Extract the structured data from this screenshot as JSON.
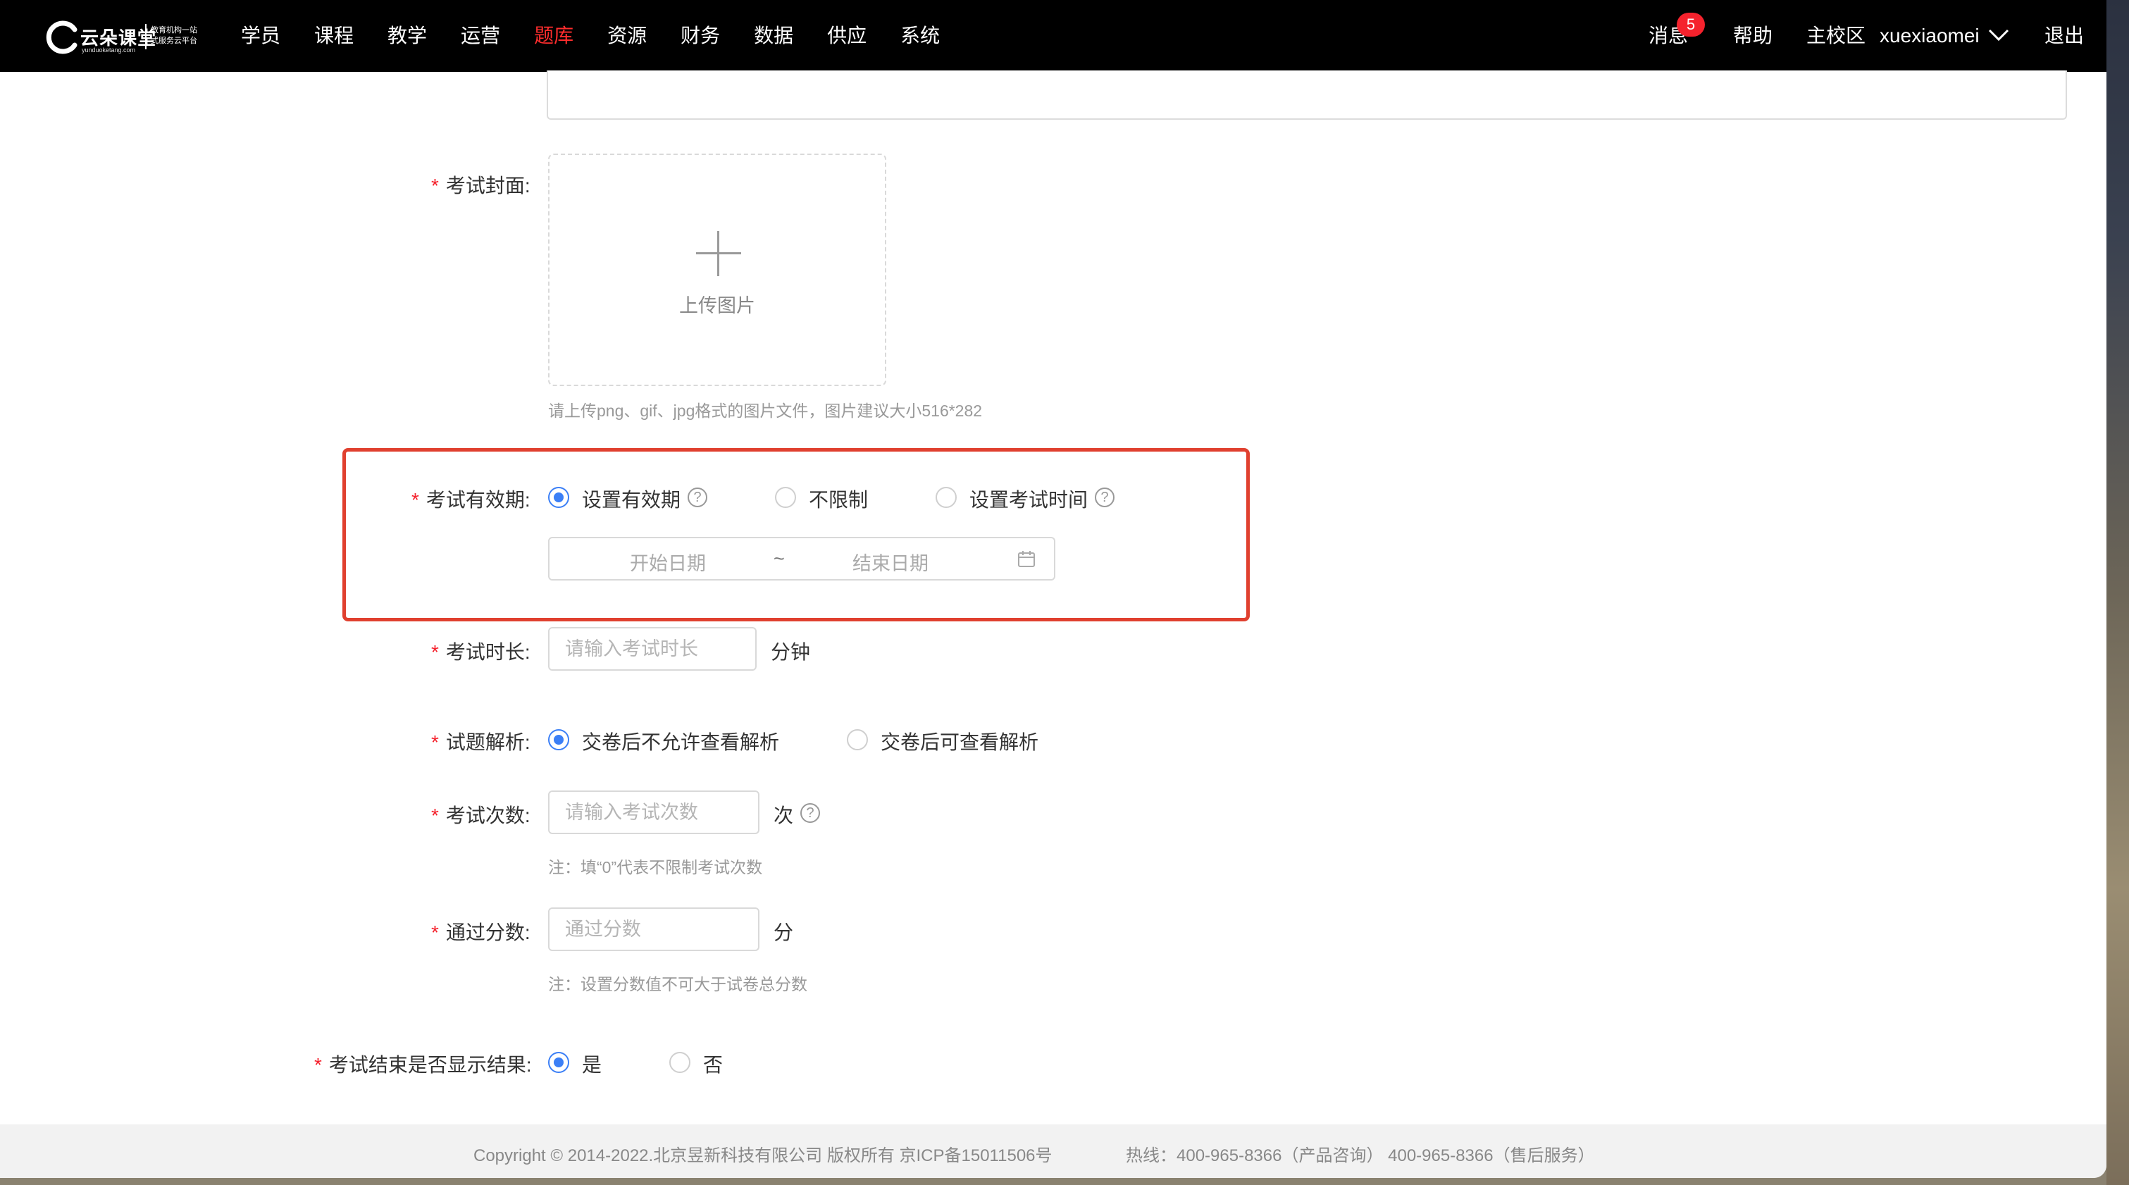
{
  "nav": {
    "logo_name": "云朵课堂",
    "logo_url": "yunduoketang.com",
    "logo_slogan_1": "教育机构一站",
    "logo_slogan_2": "式服务云平台",
    "items": [
      "学员",
      "课程",
      "教学",
      "运营",
      "题库",
      "资源",
      "财务",
      "数据",
      "供应",
      "系统"
    ],
    "active": "题库",
    "messages_label": "消息",
    "messages_count": "5",
    "help_label": "帮助",
    "campus_label": "主校区",
    "username": "xuexiaomei",
    "logout_label": "退出"
  },
  "form": {
    "cover": {
      "label": "考试封面:",
      "upload_text": "上传图片",
      "hint": "请上传png、gif、jpg格式的图片文件，图片建议大小516*282"
    },
    "validity": {
      "label": "考试有效期:",
      "options": [
        "设置有效期",
        "不限制",
        "设置考试时间"
      ],
      "selected": "设置有效期",
      "start_placeholder": "开始日期",
      "separator": "~",
      "end_placeholder": "结束日期"
    },
    "duration": {
      "label": "考试时长:",
      "placeholder": "请输入考试时长",
      "unit": "分钟"
    },
    "analysis": {
      "label": "试题解析:",
      "options": [
        "交卷后不允许查看解析",
        "交卷后可查看解析"
      ],
      "selected": "交卷后不允许查看解析"
    },
    "attempts": {
      "label": "考试次数:",
      "placeholder": "请输入考试次数",
      "unit": "次",
      "note": "注：填“0”代表不限制考试次数"
    },
    "pass_score": {
      "label": "通过分数:",
      "placeholder": "通过分数",
      "unit": "分",
      "note": "注：设置分数值不可大于试卷总分数"
    },
    "show_result": {
      "label": "考试结束是否显示结果:",
      "options": [
        "是",
        "否"
      ],
      "selected": "是"
    },
    "required_mark": "*"
  },
  "footer": {
    "copyright": "Copyright © 2014-2022.北京昱新科技有限公司 版权所有 京ICP备15011506号",
    "hotline": "热线：400-965-8366（产品咨询） 400-965-8366（售后服务）"
  },
  "colors": {
    "accent": "#3b7ff6",
    "active_nav": "#ff2d2d",
    "required": "#f5222d",
    "highlight_border": "#e0402f"
  }
}
